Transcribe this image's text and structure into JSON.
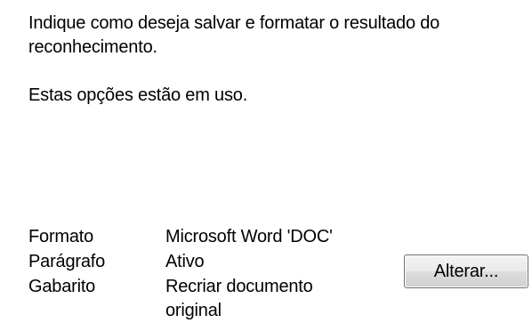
{
  "intro_text": "Indique como deseja salvar e formatar o resultado do reconhecimento.",
  "status_text": "Estas opções estão em uso.",
  "options": [
    {
      "label": "Formato",
      "value": "Microsoft Word 'DOC'"
    },
    {
      "label": "Parágrafo",
      "value": "Ativo"
    },
    {
      "label": "Gabarito",
      "value": "Recriar documento original"
    }
  ],
  "change_button_label": "Alterar..."
}
